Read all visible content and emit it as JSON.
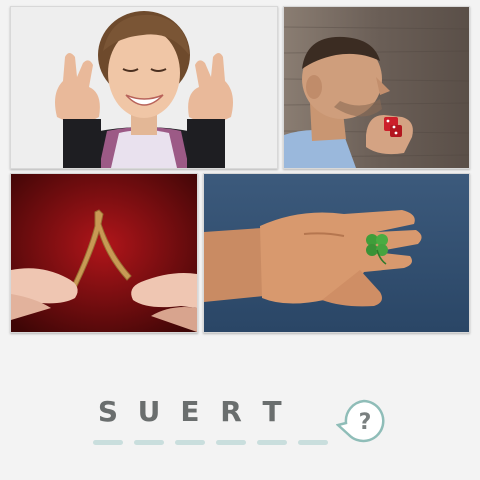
{
  "puzzle": {
    "letters": [
      "S",
      "U",
      "E",
      "R",
      "T",
      ""
    ],
    "hint_icon": "question-mark-bubble-icon"
  },
  "colors": {
    "background": "#f3f3f3",
    "letter": "#6a6e6e",
    "slot": "#c9dedd",
    "hint_border": "#8fbdb8",
    "hint_fill": "#ffffff",
    "hint_text": "#7a8080"
  },
  "tiles": [
    {
      "name": "photo-fingers-crossed"
    },
    {
      "name": "photo-blowing-dice"
    },
    {
      "name": "photo-wishbone"
    },
    {
      "name": "photo-four-leaf-clover"
    }
  ]
}
